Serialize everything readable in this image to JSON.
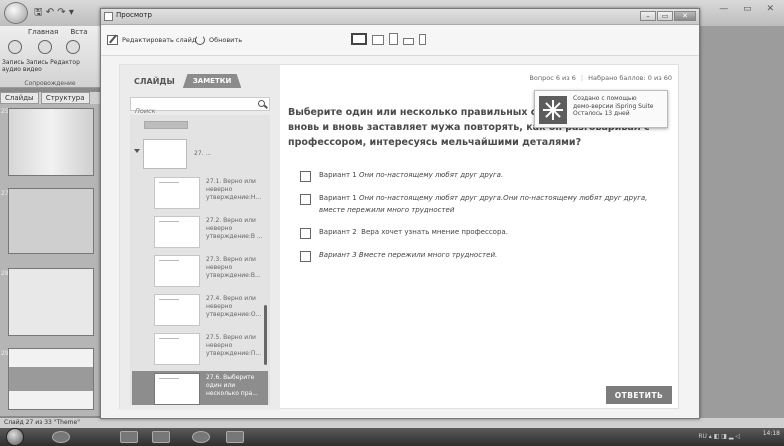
{
  "ppt": {
    "ribbon_tabs": [
      "Главная",
      "Вста"
    ],
    "ribbon_labels": "Запись Запись Редактор аудио видео",
    "ribbon_group": "Сопровождение",
    "panel_tabs": [
      "Слайды",
      "Структура"
    ],
    "slide_numbers": [
      "25",
      "27",
      "28",
      "29"
    ],
    "status": "Слайд 27 из 33  \"Theme\""
  },
  "preview": {
    "title": "Просмотр",
    "toolbar": {
      "edit_label": "Редактировать слайд",
      "refresh_label": "Обновить"
    },
    "sidebar": {
      "tab_slides": "СЛАЙДЫ",
      "tab_notes": "ЗАМЕТКИ",
      "search_placeholder": "Поиск",
      "group_label": "27. ...",
      "items": [
        {
          "label": "27.1. Верно или неверно утверждение:Н...",
          "active": false
        },
        {
          "label": "27.2. Верно или неверно утверждение:В ...",
          "active": false
        },
        {
          "label": "27.3. Верно или неверно утверждение:В...",
          "active": false
        },
        {
          "label": "27.4. Верно или неверно утверждение:О...",
          "active": false
        },
        {
          "label": "27.5. Верно или неверно утверждение:П...",
          "active": false
        },
        {
          "label": "27.6. Выберите один или несколько пра...",
          "active": true
        }
      ]
    },
    "main": {
      "question_num": "Вопрос 6 из 6",
      "score": "Набрано баллов: 0 из 60",
      "question": "Выберите один или несколько правильных ответов. Почему Вера вновь и вновь заставляет мужа повторять, как он разговаривал с профессором, интересуясь мельчайшими деталями?",
      "options": [
        {
          "prefix": "Вариант 1",
          "text": "Они по-настоящему любят друг друга."
        },
        {
          "prefix": "Вариант 1",
          "text": "Они по-настоящему любят друг друга.Они по-настоящему любят друг друга, вместе пережили много трудностей"
        },
        {
          "prefix": "Вариант 2",
          "text": "  Вера хочет узнать мнение профессора."
        },
        {
          "prefix": "",
          "text": "Вариант 3 Вместе пережили много трудностей."
        }
      ],
      "submit_label": "ОТВЕТИТЬ"
    },
    "demo": {
      "line1": "Создано с помощью",
      "line2": "демо-версии iSpring Suite",
      "line3": "Осталось 13 дней"
    }
  },
  "taskbar": {
    "lang": "RU",
    "time": "14:18"
  }
}
